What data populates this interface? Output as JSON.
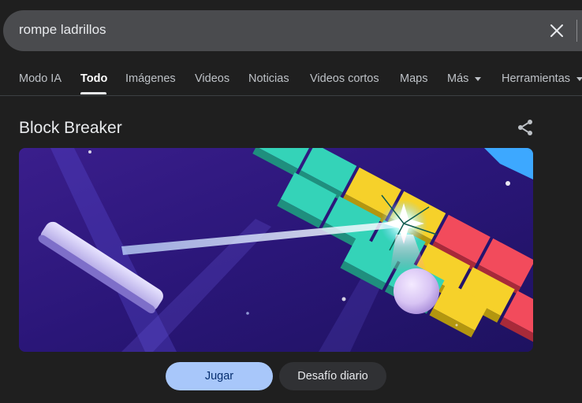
{
  "search": {
    "query": "rompe ladrillos",
    "clear_icon": "close-icon"
  },
  "tabs": [
    {
      "label": "Modo IA"
    },
    {
      "label": "Todo",
      "active": true
    },
    {
      "label": "Imágenes"
    },
    {
      "label": "Videos"
    },
    {
      "label": "Noticias"
    },
    {
      "label": "Videos cortos"
    },
    {
      "label": "Maps"
    },
    {
      "label": "Más",
      "has_dropdown": true
    },
    {
      "label": "Herramientas",
      "has_dropdown": true
    }
  ],
  "game": {
    "title": "Block Breaker",
    "share_icon": "share-icon",
    "play_label": "Jugar",
    "daily_label": "Desafío diario"
  },
  "colors": {
    "background": "#1f1f1f",
    "search_bar": "#4a4b4e",
    "play_button": "#a8c7fa",
    "daily_button": "#303134"
  }
}
